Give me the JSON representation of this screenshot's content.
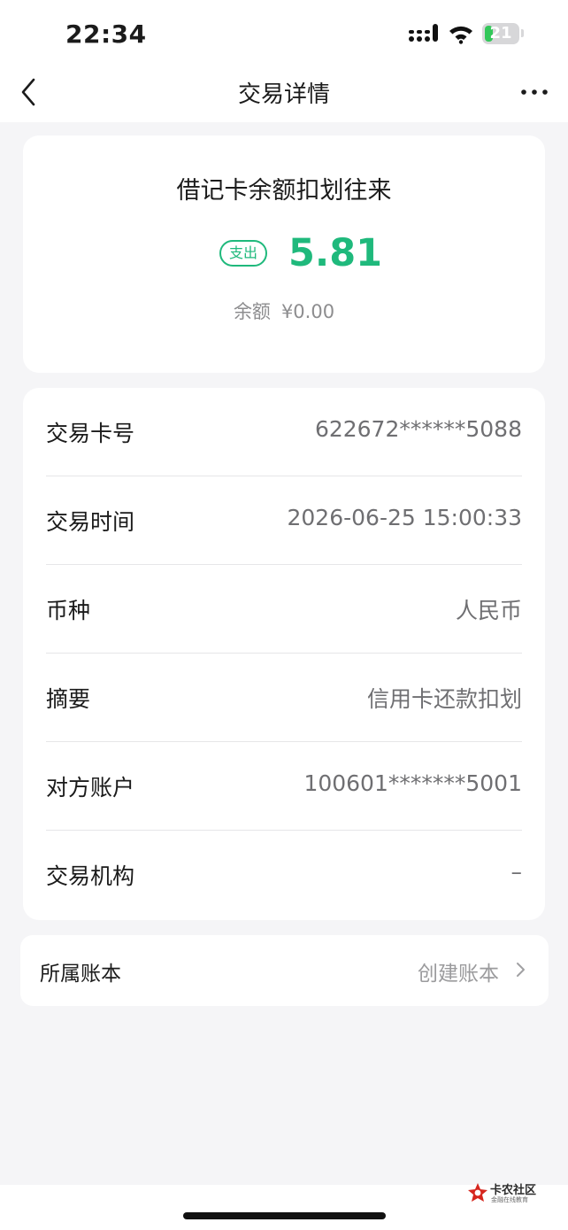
{
  "status_bar": {
    "time": "22:34",
    "battery_level": "21",
    "battery_color": "#32c759"
  },
  "nav": {
    "title": "交易详情",
    "back_icon": "chevron-left-icon",
    "more_icon": "more-horizontal-icon"
  },
  "summary": {
    "title": "借记卡余额扣划往来",
    "direction_badge": "支出",
    "amount": "5.81",
    "accent_color": "#1fb97c",
    "balance_label": "余额",
    "balance_value": "¥0.00"
  },
  "details": [
    {
      "label": "交易卡号",
      "value": "622672******5088"
    },
    {
      "label": "交易时间",
      "value": "2026-06-25 15:00:33"
    },
    {
      "label": "币种",
      "value": "人民币"
    },
    {
      "label": "摘要",
      "value": "信用卡还款扣划"
    },
    {
      "label": "对方账户",
      "value": "100601*******5001"
    },
    {
      "label": "交易机构",
      "value": "–"
    }
  ],
  "ledger": {
    "label": "所属账本",
    "action": "创建账本",
    "action_icon": "chevron-right-icon"
  },
  "watermark": {
    "title": "卡农社区",
    "subtitle": "金融在线教育"
  }
}
